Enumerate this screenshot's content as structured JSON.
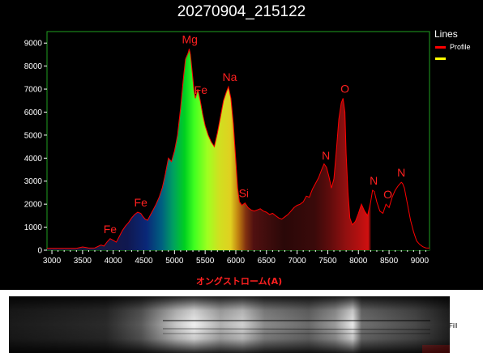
{
  "title": "20270904_215122",
  "legend": {
    "title": "Lines",
    "items": [
      {
        "label": "Profile",
        "color": "#ff0000"
      },
      {
        "label": "",
        "color": "#ffff00"
      }
    ]
  },
  "fill_label": "Fill",
  "colors": {
    "profile": "#ff0000",
    "frame": "#20a020",
    "axis": "#ffffff",
    "annotation": "#ff2020"
  },
  "chart_data": {
    "type": "area",
    "title": "20270904_215122",
    "xlabel": "オングストローム(A)",
    "ylabel": "",
    "xlim": [
      2920,
      9160
    ],
    "ylim": [
      0,
      9500
    ],
    "xticks": [
      3000,
      3500,
      4000,
      4500,
      5000,
      5500,
      6000,
      6500,
      7000,
      7500,
      8000,
      8500,
      9000
    ],
    "yticks": [
      0,
      1000,
      2000,
      3000,
      4000,
      5000,
      6000,
      7000,
      8000,
      9000
    ],
    "grid": false,
    "legend_position": "right",
    "series": [
      {
        "name": "Profile",
        "x": [
          2920,
          3000,
          3200,
          3400,
          3500,
          3550,
          3600,
          3700,
          3800,
          3850,
          3900,
          3950,
          4000,
          4050,
          4100,
          4150,
          4200,
          4250,
          4300,
          4350,
          4400,
          4450,
          4480,
          4520,
          4560,
          4600,
          4650,
          4700,
          4750,
          4800,
          4850,
          4900,
          4950,
          5000,
          5050,
          5100,
          5150,
          5180,
          5220,
          5240,
          5260,
          5290,
          5320,
          5340,
          5380,
          5420,
          5460,
          5500,
          5550,
          5600,
          5650,
          5700,
          5750,
          5800,
          5850,
          5880,
          5920,
          5960,
          5990,
          6030,
          6060,
          6100,
          6150,
          6200,
          6250,
          6300,
          6350,
          6400,
          6450,
          6500,
          6550,
          6600,
          6650,
          6700,
          6750,
          6800,
          6850,
          6900,
          6950,
          7000,
          7050,
          7100,
          7150,
          7200,
          7250,
          7300,
          7350,
          7400,
          7440,
          7480,
          7520,
          7560,
          7600,
          7640,
          7680,
          7720,
          7750,
          7780,
          7800,
          7830,
          7860,
          7900,
          7950,
          8000,
          8050,
          8100,
          8150,
          8200,
          8230,
          8260,
          8300,
          8350,
          8400,
          8450,
          8500,
          8550,
          8600,
          8650,
          8700,
          8720,
          8750,
          8800,
          8850,
          8900,
          8950,
          9000,
          9050,
          9100,
          9160
        ],
        "values": [
          80,
          80,
          80,
          80,
          140,
          120,
          90,
          100,
          220,
          180,
          360,
          500,
          430,
          350,
          600,
          850,
          1050,
          1200,
          1400,
          1550,
          1650,
          1600,
          1480,
          1350,
          1300,
          1500,
          1750,
          2000,
          2300,
          2700,
          3300,
          4000,
          3850,
          4300,
          5000,
          6200,
          7600,
          8300,
          8550,
          8750,
          8500,
          7700,
          6900,
          6600,
          7000,
          6500,
          5900,
          5400,
          5000,
          4700,
          4500,
          5100,
          5800,
          6500,
          6900,
          7100,
          6600,
          5500,
          4300,
          2700,
          2100,
          1950,
          2050,
          1850,
          1750,
          1700,
          1750,
          1800,
          1700,
          1650,
          1550,
          1600,
          1500,
          1400,
          1350,
          1450,
          1550,
          1700,
          1850,
          1950,
          2000,
          2100,
          2350,
          2300,
          2650,
          2900,
          3150,
          3500,
          3750,
          3600,
          3200,
          2700,
          3100,
          4300,
          5700,
          6400,
          6600,
          6000,
          4200,
          2500,
          1400,
          1100,
          1250,
          1600,
          2000,
          1700,
          1500,
          2100,
          2600,
          2550,
          2100,
          1700,
          1600,
          2000,
          1850,
          2300,
          2600,
          2800,
          2950,
          2900,
          2700,
          2000,
          1300,
          800,
          400,
          250,
          150,
          100,
          90
        ]
      }
    ],
    "annotations": [
      {
        "text": "Fe",
        "x": 3950,
        "y": 500
      },
      {
        "text": "Fe",
        "x": 4450,
        "y": 1650
      },
      {
        "text": "Mg",
        "x": 5250,
        "y": 8750
      },
      {
        "text": "Fe",
        "x": 5430,
        "y": 6550
      },
      {
        "text": "Na",
        "x": 5900,
        "y": 7110
      },
      {
        "text": "Si",
        "x": 6130,
        "y": 2050
      },
      {
        "text": "N",
        "x": 7470,
        "y": 3700
      },
      {
        "text": "O",
        "x": 7780,
        "y": 6600
      },
      {
        "text": "N",
        "x": 8250,
        "y": 2600
      },
      {
        "text": "O",
        "x": 8480,
        "y": 2000
      },
      {
        "text": "N",
        "x": 8700,
        "y": 2950
      }
    ]
  }
}
